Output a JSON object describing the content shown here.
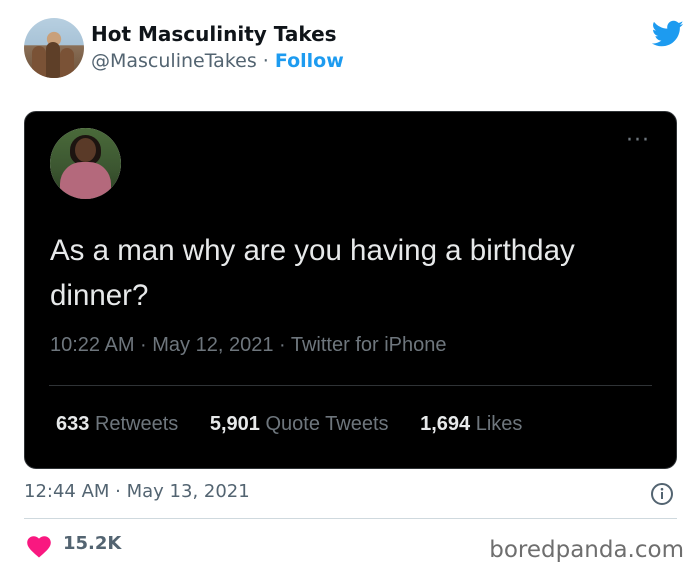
{
  "tweet": {
    "author": {
      "name": "Hot Masculinity Takes",
      "handle": "@MasculineTakes",
      "separator": " · ",
      "follow_label": "Follow"
    },
    "timestamp": "12:44 AM · May 13, 2021",
    "likes": "15.2K"
  },
  "quoted_tweet": {
    "more_label": "···",
    "text": "As a man why are you having a birthday dinner?",
    "meta": "10:22 AM · May 12, 2021 · Twitter for iPhone",
    "stats": [
      {
        "num": "633",
        "label": "Retweets"
      },
      {
        "num": "5,901",
        "label": "Quote Tweets"
      },
      {
        "num": "1,694",
        "label": "Likes"
      }
    ]
  },
  "watermark": "boredpanda.com",
  "icons": {
    "brand": "twitter-bird-icon",
    "info": "info-icon",
    "like": "heart-icon"
  },
  "colors": {
    "accent": "#1d9bf0",
    "heart": "#f91880",
    "embed_bg": "#000000"
  }
}
